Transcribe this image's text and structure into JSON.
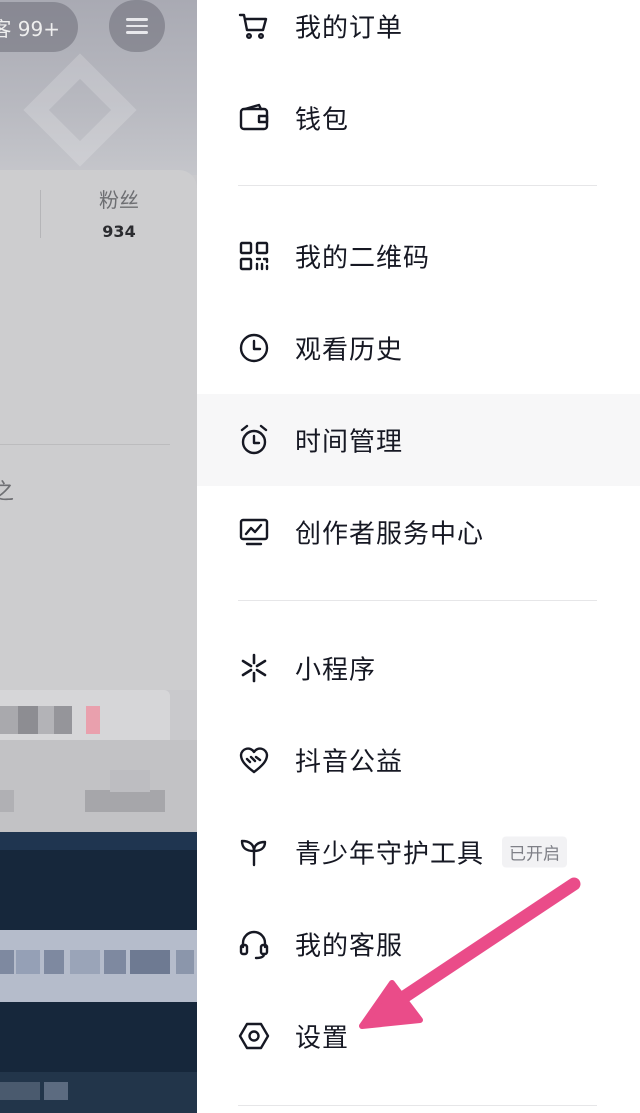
{
  "left_panel": {
    "visitor_badge": "客 99+",
    "fans_label": "粉丝",
    "fans_count": "934",
    "truncated_text": "之"
  },
  "drawer": {
    "items": [
      {
        "label": "我的订单",
        "icon": "cart-icon"
      },
      {
        "label": "钱包",
        "icon": "wallet-icon"
      },
      {
        "label": "我的二维码",
        "icon": "qr-code-icon"
      },
      {
        "label": "观看历史",
        "icon": "clock-icon"
      },
      {
        "label": "时间管理",
        "icon": "alarm-clock-icon"
      },
      {
        "label": "创作者服务中心",
        "icon": "creator-monitor-icon"
      },
      {
        "label": "小程序",
        "icon": "mini-program-icon"
      },
      {
        "label": "抖音公益",
        "icon": "charity-heart-icon"
      },
      {
        "label": "青少年守护工具",
        "icon": "sprout-icon",
        "badge": "已开启"
      },
      {
        "label": "我的客服",
        "icon": "headset-icon"
      },
      {
        "label": "设置",
        "icon": "settings-hexagon-icon"
      }
    ]
  },
  "colors": {
    "annotation_arrow": "#ea4c89",
    "text_primary": "#161823",
    "divider": "#e6e6e8",
    "dim_overlay": "#c9c9cc"
  }
}
